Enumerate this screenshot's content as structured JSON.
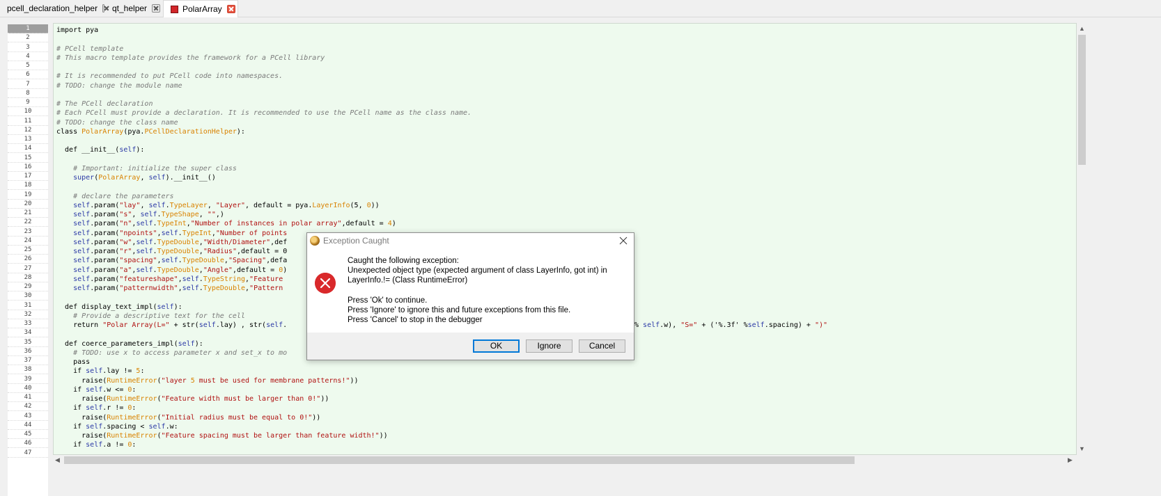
{
  "tabs": [
    {
      "label": "pcell_declaration_helper",
      "active": false
    },
    {
      "label": "qt_helper",
      "active": false
    },
    {
      "label": "PolarArray",
      "active": true
    }
  ],
  "editor": {
    "current_line": 1,
    "line_numbers": [
      "1",
      "2",
      "3",
      "4",
      "5",
      "6",
      "7",
      "8",
      "9",
      "10",
      "11",
      "12",
      "13",
      "14",
      "15",
      "16",
      "17",
      "18",
      "19",
      "20",
      "21",
      "22",
      "23",
      "24",
      "25",
      "26",
      "27",
      "28",
      "29",
      "30",
      "31",
      "32",
      "33",
      "34",
      "35",
      "36",
      "37",
      "38",
      "39",
      "40",
      "41",
      "42",
      "43",
      "44",
      "45",
      "46",
      "47"
    ],
    "lines": [
      "import pya",
      "",
      "# PCell template",
      "# This macro template provides the framework for a PCell library",
      "",
      "# It is recommended to put PCell code into namespaces.",
      "# TODO: change the module name",
      "",
      "# The PCell declaration",
      "# Each PCell must provide a declaration. It is recommended to use the PCell name as the class name.",
      "# TODO: change the class name",
      "class PolarArray(pya.PCellDeclarationHelper):",
      "",
      "  def __init__(self):",
      "",
      "    # Important: initialize the super class",
      "    super(PolarArray, self).__init__()",
      "",
      "    # declare the parameters",
      "    self.param(\"lay\", self.TypeLayer, \"Layer\", default = pya.LayerInfo(5, 0))",
      "    self.param(\"s\", self.TypeShape, \"\",)",
      "    self.param(\"n\",self.TypeInt,\"Number of instances in polar array\",default = 4)",
      "    self.param(\"npoints\",self.TypeInt,\"Number of points",
      "    self.param(\"w\",self.TypeDouble,\"Width/Diameter\",def",
      "    self.param(\"r\",self.TypeDouble,\"Radius\",default = 0",
      "    self.param(\"spacing\",self.TypeDouble,\"Spacing\",defa",
      "    self.param(\"a\",self.TypeDouble,\"Angle\",default = 0)",
      "    self.param(\"featureshape\",self.TypeString,\"Feature",
      "    self.param(\"patternwidth\",self.TypeDouble,\"Pattern",
      "",
      "  def display_text_impl(self):",
      "    # Provide a descriptive text for the cell",
      "    return \"Polar Array(L=\" + str(self.lay) , str(self.",
      "",
      "  def coerce_parameters_impl(self):",
      "    # TODO: use x to access parameter x and set_x to mo",
      "    pass",
      "    if self.lay != 5:",
      "      raise(RuntimeError(\"layer 5 must be used for membrane patterns!\"))",
      "    if self.w <= 0:",
      "      raise(RuntimeError(\"Feature width must be larger than 0!\"))",
      "    if self.r != 0:",
      "      raise(RuntimeError(\"Initial radius must be equal to 0!\"))",
      "    if self.spacing < self.w:",
      "      raise(RuntimeError(\"Feature spacing must be larger than feature width!\"))",
      "    if self.a != 0:",
      ""
    ],
    "line33_tail": "% self.w), \"S=\" + ('%.3f' %self.spacing) + \")\""
  },
  "dialog": {
    "title": "Exception Caught",
    "message_lines": [
      "Caught the following exception:",
      "Unexpected object type (expected argument of class LayerInfo, got int) in",
      "LayerInfo.!= (Class RuntimeError)",
      "",
      "Press 'Ok' to continue.",
      "Press 'Ignore' to ignore this and future exceptions from this file.",
      "Press 'Cancel' to stop in the debugger"
    ],
    "buttons": {
      "ok": "OK",
      "ignore": "Ignore",
      "cancel": "Cancel"
    }
  },
  "colors": {
    "editor_bg": "#eefaee",
    "error_red": "#d9292b",
    "focus_blue": "#0078d7"
  }
}
